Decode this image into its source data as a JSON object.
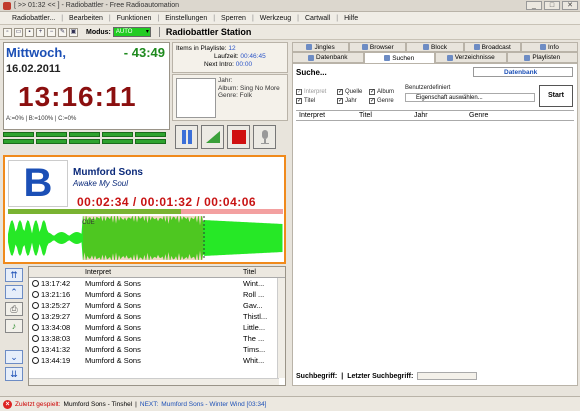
{
  "window": {
    "title": "[ >> 01:32 << ] - Radiobattler - Free Radioautomation"
  },
  "menu": [
    "Radiobattler...",
    "Bearbeiten",
    "Funktionen",
    "Einstellungen",
    "Sperren",
    "Werkzeug",
    "Cartwall",
    "Hilfe"
  ],
  "toolbar": {
    "modus_label": "Modus:",
    "modus_value": "AUTO",
    "station": "Radiobattler Station"
  },
  "clock": {
    "day": "Mittwoch,",
    "countdown": "- 43:49",
    "date": "16.02.2011",
    "time": "13:16:11",
    "abc": "A:=0%   |   B:=100%   |   C:=0%"
  },
  "playlist_info": {
    "items_label": "Items in Playliste:",
    "items_value": "12",
    "laufzeit_label": "Laufzeit:",
    "laufzeit_value": "00:46:45",
    "intro_label": "Next Intro:",
    "intro_value": "00:00"
  },
  "track_info": {
    "jahr": "Jahr:",
    "album": "Album: Sing No More",
    "genre": "Genre: Folk"
  },
  "now_playing": {
    "letter": "B",
    "artist": "Mumford Sons",
    "title": "Awake My Soul",
    "times": "00:02:34 / 00:01:32 / 00:04:06",
    "progress": 0.63,
    "cue": "CUE"
  },
  "playlist": {
    "headers": [
      "",
      "Interpret",
      "Titel"
    ],
    "rows": [
      {
        "time": "13:17:42",
        "artist": "Mumford & Sons",
        "title": "Wint..."
      },
      {
        "time": "13:21:16",
        "artist": "Mumford & Sons",
        "title": "Roll ..."
      },
      {
        "time": "13:25:27",
        "artist": "Mumford & Sons",
        "title": "Gav..."
      },
      {
        "time": "13:29:27",
        "artist": "Mumford & Sons",
        "title": "Thistl..."
      },
      {
        "time": "13:34:08",
        "artist": "Mumford & Sons",
        "title": "Little..."
      },
      {
        "time": "13:38:03",
        "artist": "Mumford & Sons",
        "title": "The ..."
      },
      {
        "time": "13:41:32",
        "artist": "Mumford & Sons",
        "title": "Tims..."
      },
      {
        "time": "13:44:19",
        "artist": "Mumford & Sons",
        "title": "Whit..."
      }
    ]
  },
  "tabs_top": [
    "Jingles",
    "Browser",
    "Block",
    "Broadcast",
    "Info"
  ],
  "tabs_bottom": [
    "Datenbank",
    "Suchen",
    "Verzeichnisse",
    "Playlisten"
  ],
  "search": {
    "header": "Suche...",
    "source": "Datenbank",
    "checks": [
      {
        "label": "Interpret",
        "checked": true,
        "disabled": true
      },
      {
        "label": "Quelle",
        "checked": true,
        "disabled": false
      },
      {
        "label": "Album",
        "checked": true,
        "disabled": false
      },
      {
        "label": "Titel",
        "checked": true,
        "disabled": false
      },
      {
        "label": "Jahr",
        "checked": true,
        "disabled": false
      },
      {
        "label": "Genre",
        "checked": true,
        "disabled": false
      }
    ],
    "custom_label": "Benutzerdefiniert",
    "custom_placeholder": "Eigenschaft auswählen...",
    "start": "Start",
    "columns": [
      "Interpret",
      "Titel",
      "Jahr",
      "Genre"
    ],
    "footer_label1": "Suchbegriff:",
    "footer_sep": "|",
    "footer_label2": "Letzter Suchbegriff:"
  },
  "status": {
    "played_label": "Zuletzt gespielt:",
    "played": "Mumford Sons - Tinshel",
    "next_label": "NEXT:",
    "next": "Mumford Sons - Winter Wind [03:34]"
  }
}
